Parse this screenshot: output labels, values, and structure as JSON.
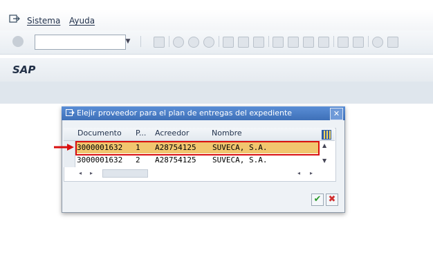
{
  "menu": {
    "items": [
      {
        "label": "Sistema"
      },
      {
        "label": "Ayuda"
      }
    ]
  },
  "toolbar": {
    "command_field_value": ""
  },
  "header": {
    "title": "SAP"
  },
  "dialog": {
    "title": "Elejir proveedor para el plan de entregas del expediente",
    "columns": [
      "Documento",
      "P...",
      "Acreedor",
      "Nombre"
    ],
    "rows": [
      {
        "documento": "3000001632",
        "p": "1",
        "acreedor": "A28754125",
        "nombre": "SUVECA, S.A.",
        "selected": true
      },
      {
        "documento": "3000001632",
        "p": "2",
        "acreedor": "A28754125",
        "nombre": "SUVECA, S.A.",
        "selected": false
      }
    ],
    "ok_icon": "checkmark-icon",
    "cancel_icon": "cancel-x-icon"
  },
  "colors": {
    "dialog_header": "#4a80c8",
    "selected_row": "#f1c66f",
    "highlight_box": "#d90f0f"
  }
}
